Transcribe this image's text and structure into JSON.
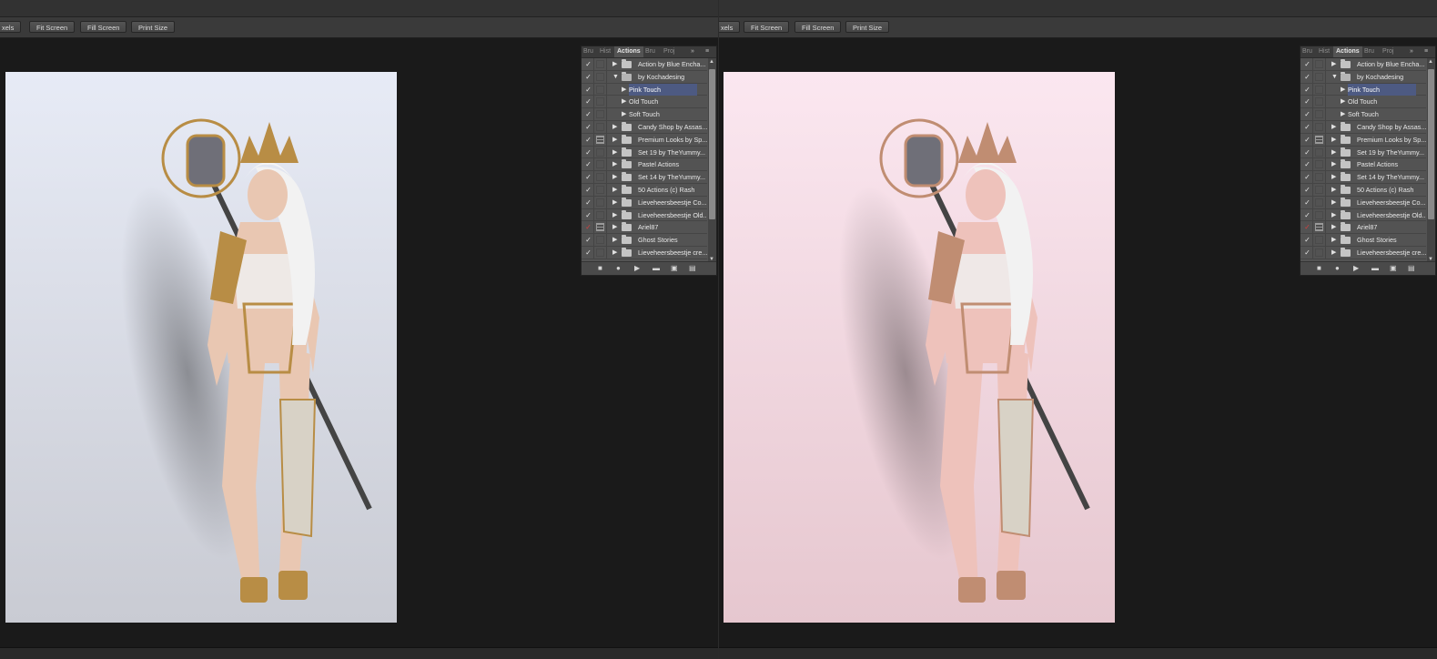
{
  "options_bar": {
    "pixels_label": "xels",
    "fit_screen_label": "Fit Screen",
    "fill_screen_label": "Fill Screen",
    "print_size_label": "Print Size"
  },
  "actions_panel": {
    "tabs": [
      "Bru",
      "Hist",
      "Actions",
      "Bru",
      "Proj"
    ],
    "active_tab": "Actions",
    "expand_glyph": "»",
    "menu_glyph": "≡",
    "items": [
      {
        "label": "Action by Blue Encha...",
        "check": "✓",
        "dialog": false,
        "level": 0,
        "open": false,
        "selected": false
      },
      {
        "label": "by Kochadesing",
        "check": "✓",
        "dialog": false,
        "level": 0,
        "open": true,
        "selected": false
      },
      {
        "label": "Pink Touch",
        "check": "✓",
        "dialog": false,
        "level": 1,
        "open": false,
        "selected": true
      },
      {
        "label": "Old Touch",
        "check": "✓",
        "dialog": false,
        "level": 1,
        "open": false,
        "selected": false
      },
      {
        "label": "Soft Touch",
        "check": "✓",
        "dialog": false,
        "level": 1,
        "open": false,
        "selected": false
      },
      {
        "label": "Candy Shop by Assas...",
        "check": "✓",
        "dialog": false,
        "level": 0,
        "open": false,
        "selected": false
      },
      {
        "label": "Premium Looks by Sp...",
        "check": "✓",
        "dialog": true,
        "level": 0,
        "open": false,
        "selected": false
      },
      {
        "label": "Set 19 by TheYummy...",
        "check": "✓",
        "dialog": false,
        "level": 0,
        "open": false,
        "selected": false
      },
      {
        "label": "Pastel Actions",
        "check": "✓",
        "dialog": false,
        "level": 0,
        "open": false,
        "selected": false
      },
      {
        "label": "Set 14 by TheYummy...",
        "check": "✓",
        "dialog": false,
        "level": 0,
        "open": false,
        "selected": false
      },
      {
        "label": "50 Actions (c) Rash",
        "check": "✓",
        "dialog": false,
        "level": 0,
        "open": false,
        "selected": false
      },
      {
        "label": "Lieveheersbeestje Co...",
        "check": "✓",
        "dialog": false,
        "level": 0,
        "open": false,
        "selected": false
      },
      {
        "label": "Lieveheersbeestje Old...",
        "check": "✓",
        "dialog": false,
        "level": 0,
        "open": false,
        "selected": false
      },
      {
        "label": "Ariel87",
        "check": "✓",
        "dialog": true,
        "level": 0,
        "open": false,
        "selected": false,
        "red": true
      },
      {
        "label": "Ghost Stories",
        "check": "✓",
        "dialog": false,
        "level": 0,
        "open": false,
        "selected": false
      },
      {
        "label": "Lieveheersbeestje cre...",
        "check": "✓",
        "dialog": false,
        "level": 0,
        "open": false,
        "selected": false
      }
    ],
    "footer_icons": [
      "stop-icon",
      "record-icon",
      "play-icon",
      "new-set-icon",
      "new-action-icon",
      "delete-icon"
    ]
  },
  "images": {
    "before": {
      "bg_top": "#e7ebf6",
      "bg_bottom": "#c9cbd3",
      "skin": "#e9c7b2",
      "gold": "#b88d45"
    },
    "after": {
      "bg_top": "#fbe7f0",
      "bg_bottom": "#e6c7cf",
      "skin": "#eec2bb",
      "gold": "#c08d72"
    }
  }
}
